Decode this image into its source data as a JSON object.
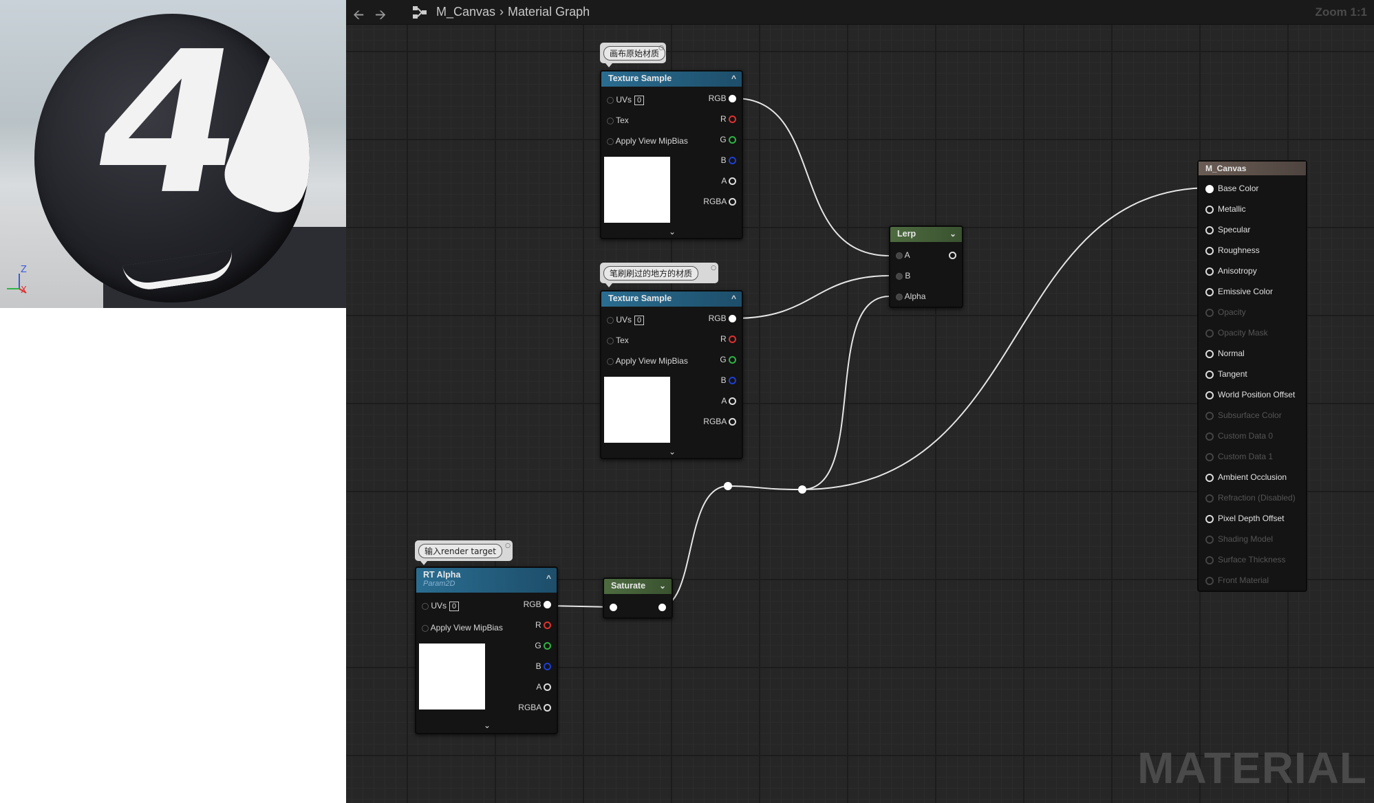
{
  "preview": {
    "sphere_number": "4",
    "axis_z": "Z",
    "axis_x": "X"
  },
  "toolbar": {
    "back_icon": "arrow-left-icon",
    "forward_icon": "arrow-right-icon",
    "graph_icon": "graph-hierarchy-icon",
    "breadcrumb_asset": "M_Canvas",
    "breadcrumb_graph": "Material Graph",
    "zoom": "Zoom 1:1"
  },
  "watermark": "MATERIAL",
  "comments": {
    "canvas_original": "画布原始材质",
    "brushed_area": "笔刷刷过的地方的材质",
    "input_rt": "输入render target"
  },
  "texture_sample_1": {
    "title": "Texture Sample",
    "inputs": {
      "uvs": "UVs",
      "uvs_value": "0",
      "tex": "Tex",
      "mip": "Apply View MipBias"
    },
    "outputs": {
      "rgb": "RGB",
      "r": "R",
      "g": "G",
      "b": "B",
      "a": "A",
      "rgba": "RGBA"
    }
  },
  "texture_sample_2": {
    "title": "Texture Sample",
    "inputs": {
      "uvs": "UVs",
      "uvs_value": "0",
      "tex": "Tex",
      "mip": "Apply View MipBias"
    },
    "outputs": {
      "rgb": "RGB",
      "r": "R",
      "g": "G",
      "b": "B",
      "a": "A",
      "rgba": "RGBA"
    }
  },
  "rt_alpha": {
    "title": "RT Alpha",
    "subtitle": "Param2D",
    "inputs": {
      "uvs": "UVs",
      "uvs_value": "0",
      "mip": "Apply View MipBias"
    },
    "outputs": {
      "rgb": "RGB",
      "r": "R",
      "g": "G",
      "b": "B",
      "a": "A",
      "rgba": "RGBA"
    }
  },
  "lerp": {
    "title": "Lerp",
    "a": "A",
    "b": "B",
    "alpha": "Alpha"
  },
  "saturate": {
    "title": "Saturate"
  },
  "result": {
    "title": "M_Canvas",
    "pins": [
      {
        "label": "Base Color",
        "enabled": true,
        "connected": true
      },
      {
        "label": "Metallic",
        "enabled": true,
        "connected": false
      },
      {
        "label": "Specular",
        "enabled": true,
        "connected": false
      },
      {
        "label": "Roughness",
        "enabled": true,
        "connected": false
      },
      {
        "label": "Anisotropy",
        "enabled": true,
        "connected": false
      },
      {
        "label": "Emissive Color",
        "enabled": true,
        "connected": false
      },
      {
        "label": "Opacity",
        "enabled": false,
        "connected": false
      },
      {
        "label": "Opacity Mask",
        "enabled": false,
        "connected": false
      },
      {
        "label": "Normal",
        "enabled": true,
        "connected": false
      },
      {
        "label": "Tangent",
        "enabled": true,
        "connected": false
      },
      {
        "label": "World Position Offset",
        "enabled": true,
        "connected": false
      },
      {
        "label": "Subsurface Color",
        "enabled": false,
        "connected": false
      },
      {
        "label": "Custom Data 0",
        "enabled": false,
        "connected": false
      },
      {
        "label": "Custom Data 1",
        "enabled": false,
        "connected": false
      },
      {
        "label": "Ambient Occlusion",
        "enabled": true,
        "connected": false
      },
      {
        "label": "Refraction (Disabled)",
        "enabled": false,
        "connected": false
      },
      {
        "label": "Pixel Depth Offset",
        "enabled": true,
        "connected": false
      },
      {
        "label": "Shading Model",
        "enabled": false,
        "connected": false
      },
      {
        "label": "Surface Thickness",
        "enabled": false,
        "connected": false
      },
      {
        "label": "Front Material",
        "enabled": false,
        "connected": false
      }
    ]
  },
  "colors": {
    "graph_bg": "#262626",
    "texture_header": "#2a6d91",
    "math_header": "#4d6b3f",
    "result_header": "#6a5c54",
    "pin_r": "#e03131",
    "pin_g": "#2fb344",
    "pin_b": "#1c3fd6"
  }
}
